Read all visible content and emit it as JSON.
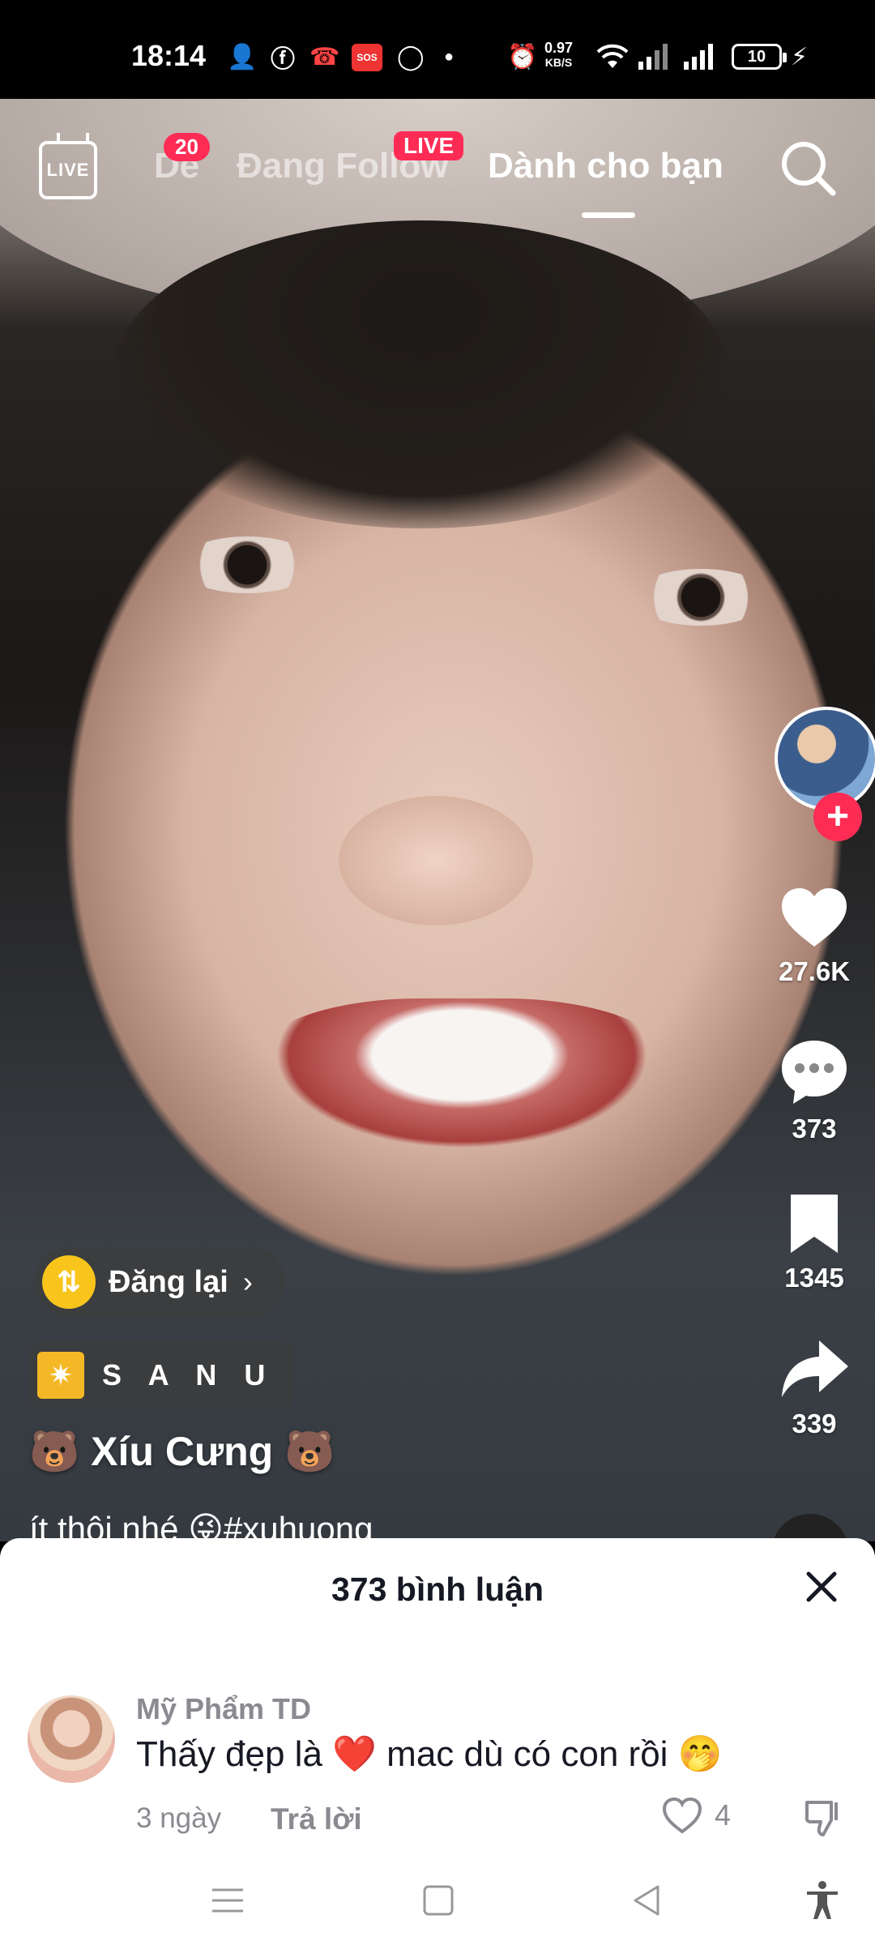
{
  "status_bar": {
    "time": "18:14",
    "speed_value": "0.97",
    "speed_unit": "KB/S",
    "battery": "10",
    "sos": "SOS"
  },
  "top_nav": {
    "live_label": "LIVE",
    "tab_partial": "De",
    "tab_partial_badge": "20",
    "tab_following": "Đang Follow",
    "live_badge": "LIVE",
    "tab_for_you": "Dành cho bạn"
  },
  "right_rail": {
    "likes": "27.6K",
    "comments": "373",
    "saves": "1345",
    "shares": "339",
    "like_icon_color": "#ffffff",
    "follow_color": "#fe2c55"
  },
  "video_info": {
    "repost_label": "Đăng lại",
    "sound_label": "S A N U",
    "author": "🐻  Xíu  Cưng  🐻",
    "caption": "ít thôi nhé 😜#xuhuong"
  },
  "comments_sheet": {
    "title": "373 bình luận",
    "comment": {
      "username": "Mỹ Phẩm TD",
      "text": "Thấy đẹp là ❤️ mac dù có con rồi 🤭",
      "time": "3 ngày",
      "reply_label": "Trả lời",
      "like_count": "4"
    }
  }
}
